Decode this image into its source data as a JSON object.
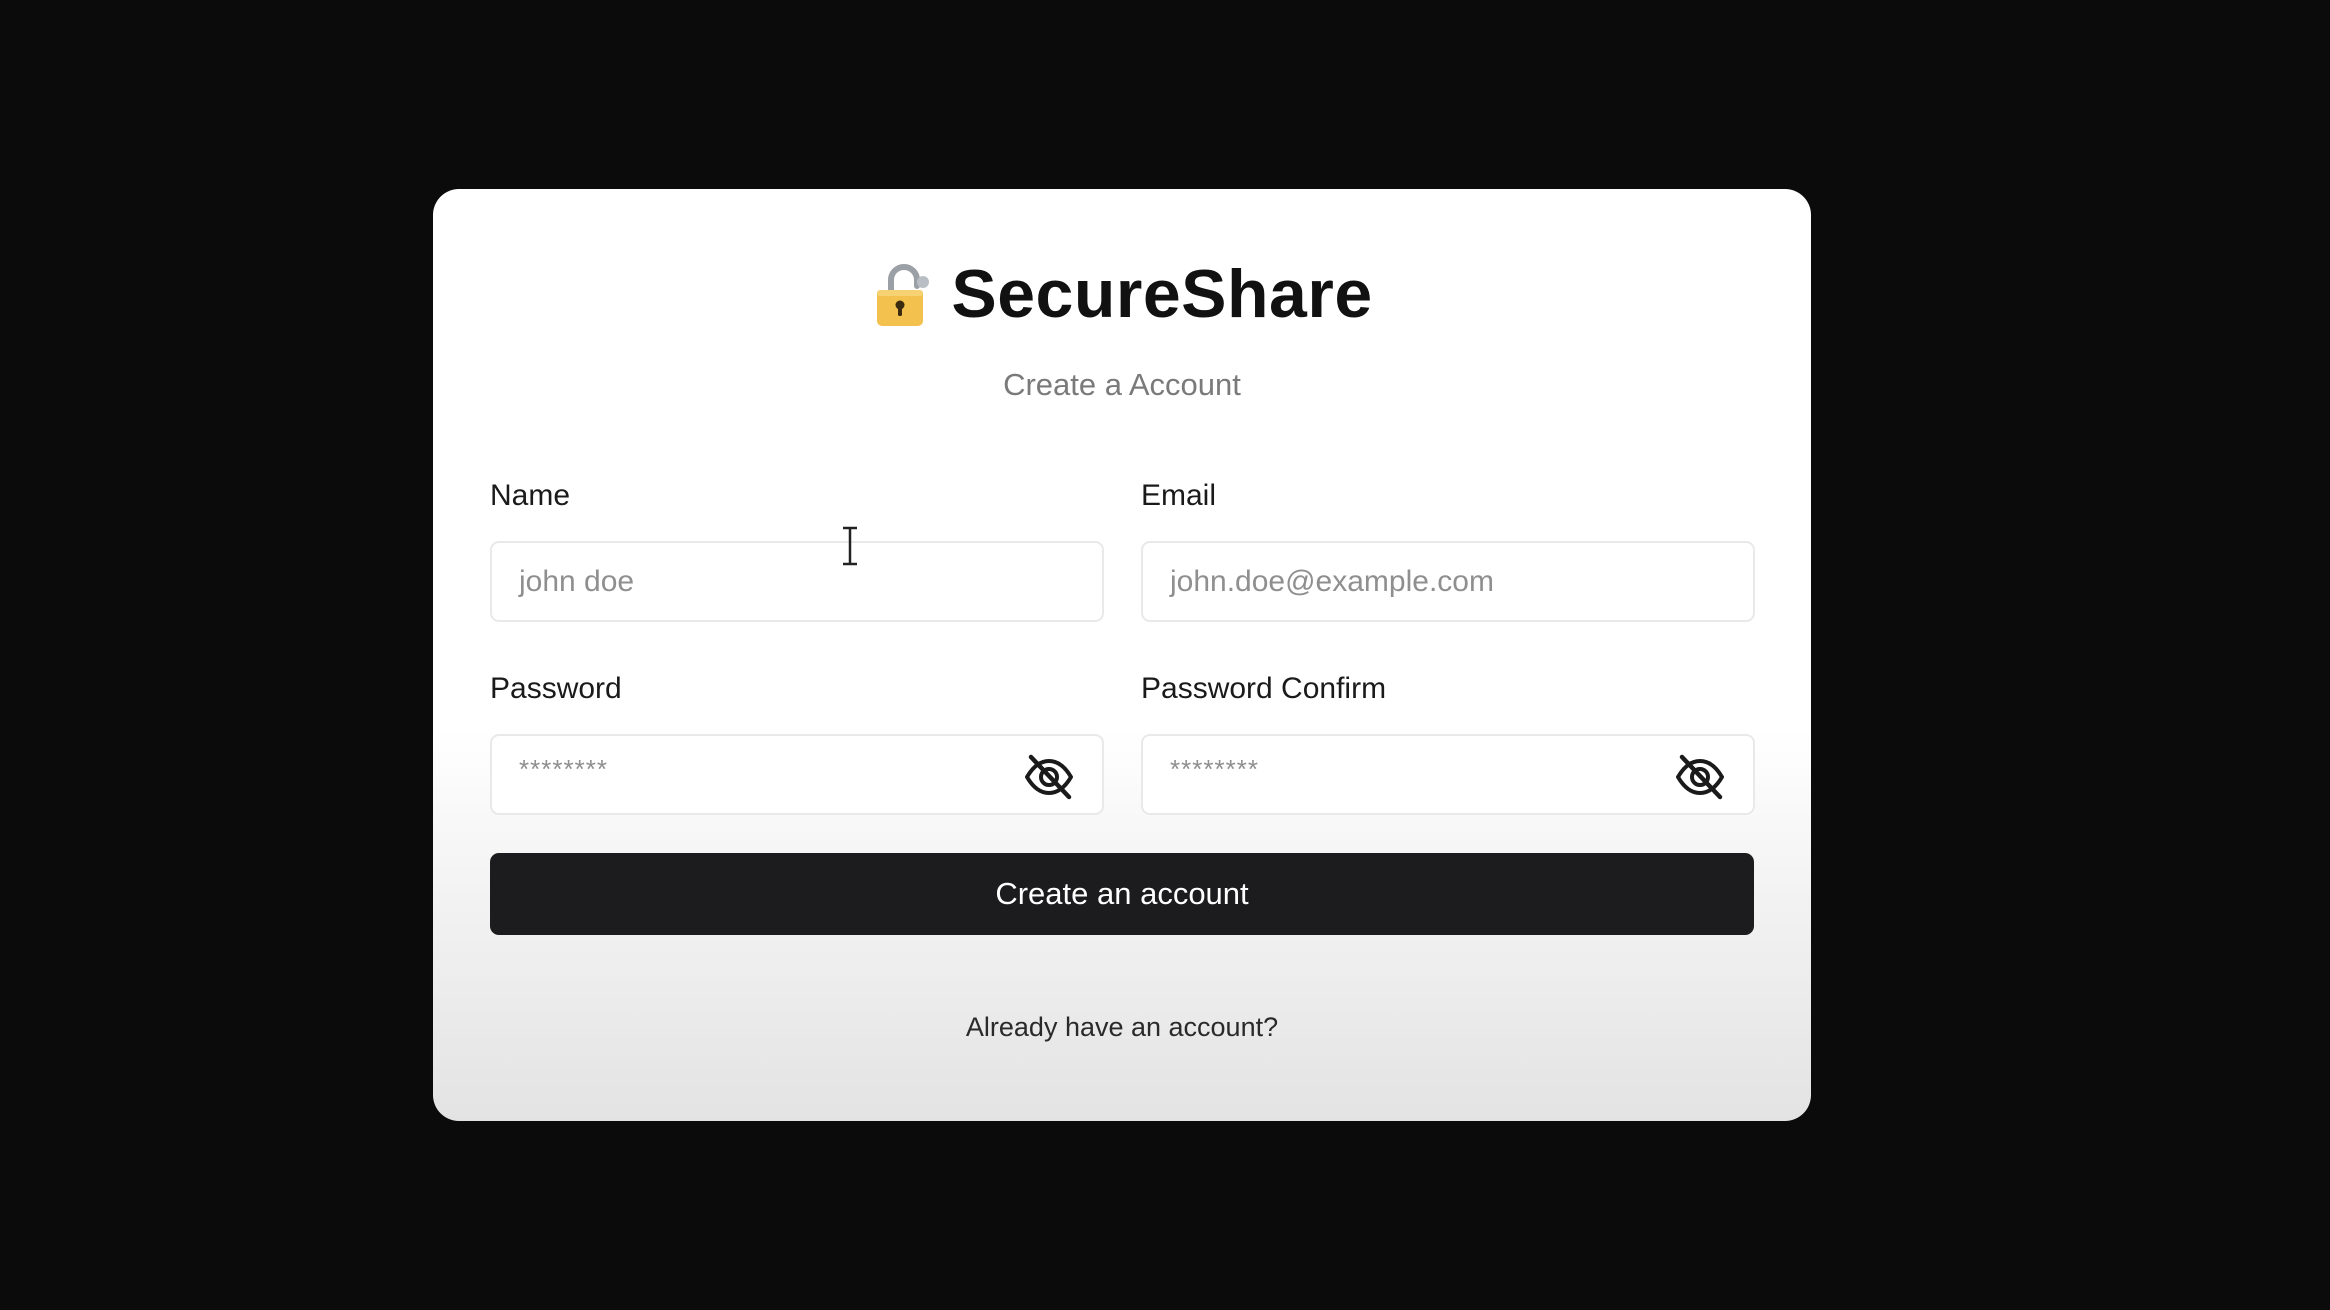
{
  "brand": {
    "title": "SecureShare",
    "icon": "lock-icon",
    "icon_color": "#f2c14e"
  },
  "form": {
    "subtitle": "Create a Account",
    "name": {
      "label": "Name",
      "placeholder": "john doe",
      "value": ""
    },
    "email": {
      "label": "Email",
      "placeholder": "john.doe@example.com",
      "value": ""
    },
    "password": {
      "label": "Password",
      "placeholder": "********",
      "toggle_icon": "eye-off-icon"
    },
    "password_confirm": {
      "label": "Password Confirm",
      "placeholder": "********",
      "toggle_icon": "eye-off-icon"
    },
    "submit_label": "Create an account",
    "login_link": "Already have an account?"
  },
  "colors": {
    "background": "#0b0b0c",
    "card": "#ffffff",
    "button": "#1c1c1e",
    "button_text": "#ffffff"
  }
}
